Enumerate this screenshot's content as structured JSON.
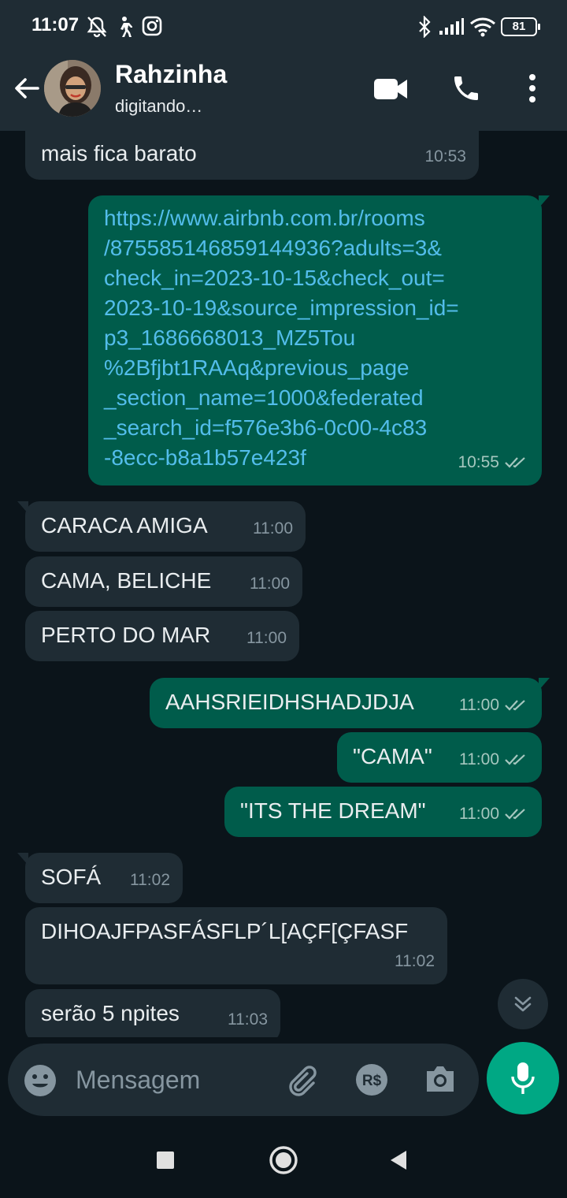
{
  "status_bar": {
    "time": "11:07",
    "battery": "81"
  },
  "header": {
    "contact_name": "Rahzinha",
    "contact_status": "digitando…"
  },
  "messages": [
    {
      "direction": "in",
      "text": "mais fica barato",
      "time": "10:53"
    },
    {
      "direction": "out",
      "type": "link",
      "lines": [
        "https://www.airbnb.com.br/rooms",
        "/875585146859144936?adults=3&",
        "check_in=2023-10-15&check_out=",
        "2023-10-19&source_impression_id=",
        "p3_1686668013_MZ5Tou",
        "%2Bfjbt1RAAq&previous_page",
        "_section_name=1000&federated",
        "_search_id=f576e3b6-0c00-4c83",
        "-8ecc-b8a1b57e423f"
      ],
      "time": "10:55"
    },
    {
      "direction": "in",
      "text": "CARACA AMIGA",
      "time": "11:00"
    },
    {
      "direction": "in",
      "text": "CAMA, BELICHE",
      "time": "11:00"
    },
    {
      "direction": "in",
      "text": "PERTO DO MAR",
      "time": "11:00"
    },
    {
      "direction": "out",
      "text": "AAHSRIEIDHSHADJDJA",
      "time": "11:00"
    },
    {
      "direction": "out",
      "text": "\"CAMA\"",
      "time": "11:00"
    },
    {
      "direction": "out",
      "text": "\"ITS THE DREAM\"",
      "time": "11:00"
    },
    {
      "direction": "in",
      "text": "SOFÁ",
      "time": "11:02"
    },
    {
      "direction": "in",
      "text": "DIHOAJFPASFÁSFLP´L[AÇF[ÇFASF",
      "time": "11:02"
    },
    {
      "direction": "in",
      "text": "serão 5 npites",
      "time": "11:03"
    }
  ],
  "input": {
    "placeholder": "Mensagem"
  },
  "colors": {
    "background": "#0b141a",
    "header": "#1f2c34",
    "incoming_bubble": "#1f2c34",
    "outgoing_bubble": "#005c4b",
    "link": "#53bdeb",
    "accent": "#00a884",
    "meta_text": "#8696a0"
  },
  "icons": {
    "status_bar": [
      "notifications-off-icon",
      "walking-icon",
      "instagram-icon",
      "bluetooth-icon",
      "signal-icon",
      "wifi-icon",
      "battery-icon"
    ],
    "header": [
      "back-arrow-icon",
      "video-call-icon",
      "phone-icon",
      "more-vert-icon"
    ],
    "input_bar": [
      "emoji-icon",
      "attach-icon",
      "payment-icon",
      "camera-icon",
      "mic-icon"
    ],
    "nav_bar": [
      "recents-icon",
      "home-icon",
      "back-icon"
    ],
    "chat": [
      "double-check-icon",
      "scroll-down-icon"
    ]
  }
}
